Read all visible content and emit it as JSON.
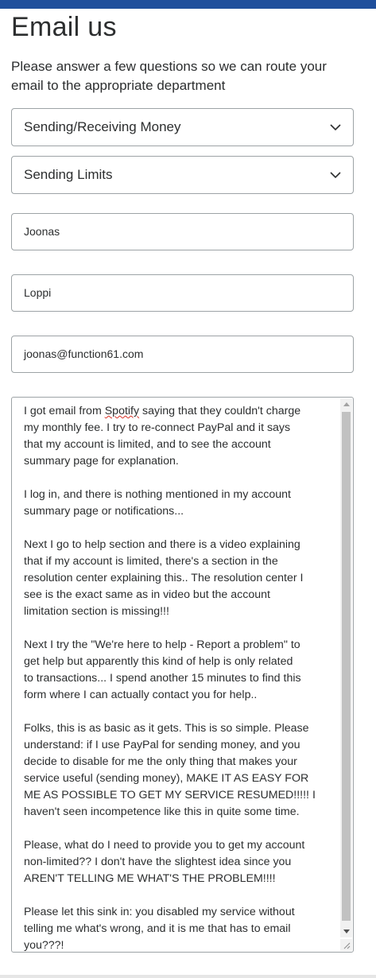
{
  "form": {
    "title": "Email us",
    "intro": "Please answer a few questions so we can route your email to the appropriate department",
    "topic_select": {
      "value": "Sending/Receiving Money"
    },
    "subtopic_select": {
      "value": "Sending Limits"
    },
    "first_name": {
      "value": "Joonas"
    },
    "last_name": {
      "value": "Loppi"
    },
    "email": {
      "value": "joonas@function61.com"
    },
    "message": {
      "line1_before": "I got email from ",
      "line1_misspelled": "Spotify",
      "rest": " saying that they couldn't charge\nmy monthly fee. I try to re-connect PayPal and it says\nthat my account is limited, and to see the account\nsummary page for explanation.\n\nI log in, and there is nothing mentioned in my account\nsummary page or notifications...\n\nNext I go to help section and there is a video explaining\nthat if my account is limited, there's a section in the\nresolution center explaining this.. The resolution center I\nsee is the exact same as in video but the account\nlimitation section is missing!!!\n\nNext I try the \"We're here to help - Report a problem\" to\nget help but apparently this kind of help is only related\nto transactions... I spend another 15 minutes to find this\nform where I can actually contact you for help..\n\nFolks, this is as basic as it gets. This is so simple. Please\nunderstand: if I use PayPal for sending money, and you\ndecide to disable for me the only thing that makes your\nservice useful (sending money), MAKE IT AS EASY FOR\nME AS POSSIBLE TO GET MY SERVICE RESUMED!!!!! I\nhaven't seen incompetence like this in quite some time.\n\nPlease, what do I need to provide you to get my account\nnon-limited?? I don't have the slightest idea since you\nAREN'T TELLING ME WHAT'S THE PROBLEM!!!!\n\nPlease let this sink in: you disabled my service without\ntelling me what's wrong, and it is me that has to email\nyou???!"
    }
  },
  "colors": {
    "top_bar": "#1f4f9c",
    "border": "#9da3a6",
    "text": "#2c2e2f"
  },
  "icons": {
    "select_chevron": "chevron-down-icon",
    "scroll_up": "scroll-up-arrow-icon",
    "scroll_down": "scroll-down-arrow-icon",
    "resize": "resize-grip-icon"
  }
}
